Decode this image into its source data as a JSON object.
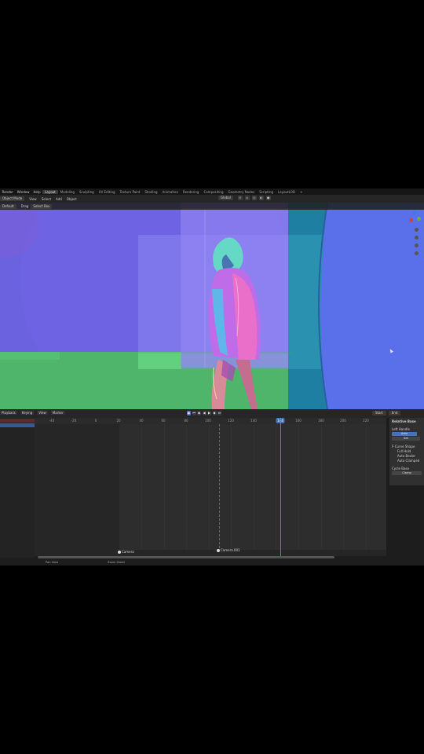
{
  "menubar": {
    "items": [
      "Render",
      "Window",
      "Help"
    ],
    "workspaces": [
      "Layout",
      "Modeling",
      "Sculpting",
      "UV Editing",
      "Texture Paint",
      "Shading",
      "Animation",
      "Rendering",
      "Compositing",
      "Geometry Nodes",
      "Scripting",
      "LayoutLOD"
    ],
    "active_workspace": "Layout",
    "add_tab": "+"
  },
  "header": {
    "mode": "Object Mode",
    "menus": [
      "View",
      "Select",
      "Add",
      "Object"
    ],
    "transform": "Global"
  },
  "toolrow": {
    "mode": "Default",
    "drag": "Drag",
    "select": "Select Box"
  },
  "timeline": {
    "menus": [
      "Playback",
      "Keying",
      "View",
      "Marker"
    ],
    "ticks": [
      "-40",
      "-20",
      "0",
      "20",
      "40",
      "60",
      "80",
      "100",
      "120",
      "140",
      "160",
      "180",
      "200",
      "220"
    ],
    "current_frame": "144",
    "right_buttons": [
      "Start",
      "End"
    ],
    "markers": [
      "Camera",
      "Camera.001"
    ]
  },
  "statusbar": {
    "items": [
      "Pan View",
      "Zoom Sheet"
    ]
  },
  "right_panel": {
    "title": "Relative Base",
    "left_handle_label": "Left Handle",
    "auto_value": "Auto",
    "set_label": "Set",
    "fcurve_label": "F-Curve Shape",
    "options": [
      "Full Hold",
      "Auto Bezier",
      "Auto Clamped"
    ],
    "cycle_label": "Cycle Base",
    "cycle_value": "Clamp"
  },
  "colors": {
    "accent": "#4772b3",
    "normal_purple": "#7a6be8",
    "normal_blue": "#5a6ff0",
    "normal_green": "#4fc06a",
    "normal_teal": "#1b7d9c"
  }
}
